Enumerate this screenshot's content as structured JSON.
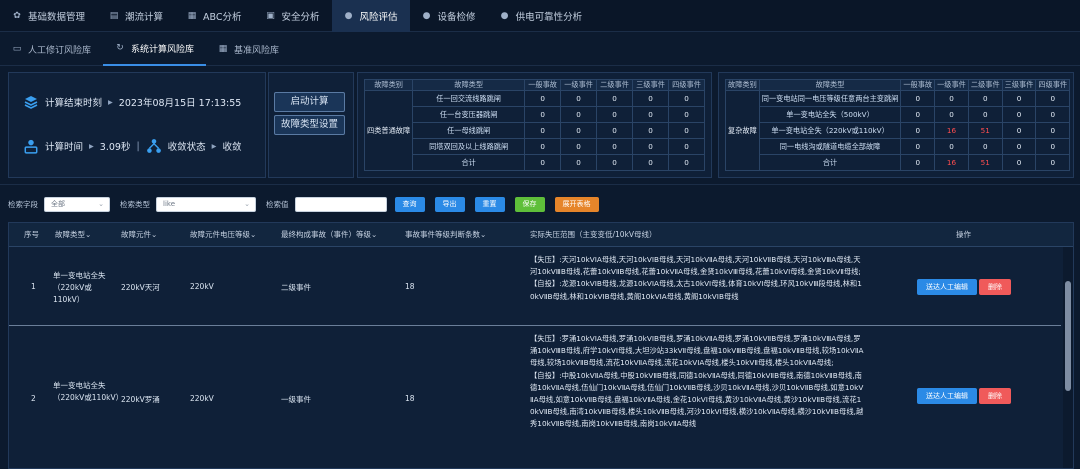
{
  "top_nav": [
    {
      "label": "基础数据管理",
      "icon": "gear-icon",
      "glyph": "✿"
    },
    {
      "label": "潮流计算",
      "icon": "document-icon",
      "glyph": "▤"
    },
    {
      "label": "ABC分析",
      "icon": "abc-icon",
      "glyph": "▦"
    },
    {
      "label": "安全分析",
      "icon": "monitor-icon",
      "glyph": "▣"
    },
    {
      "label": "风险评估",
      "icon": "user-icon",
      "glyph": "●",
      "active": true
    },
    {
      "label": "设备检修",
      "icon": "user-icon",
      "glyph": "●"
    },
    {
      "label": "供电可靠性分析",
      "icon": "user-icon",
      "glyph": "●"
    }
  ],
  "sub_nav": [
    {
      "label": "人工修订风险库",
      "icon": "monitor-icon",
      "glyph": "▭"
    },
    {
      "label": "系统计算风险库",
      "icon": "refresh-icon",
      "glyph": "↻",
      "active": true
    },
    {
      "label": "基准风险库",
      "icon": "grid-icon",
      "glyph": "▦"
    }
  ],
  "status": {
    "end_label": "计算结束时刻",
    "end_value": "2023年08月15日 17:13:55",
    "time_label": "计算时间",
    "time_value": "3.09秒",
    "sep": "|",
    "state_label": "收敛状态",
    "state_value": "收敛",
    "start_button": "启动计算",
    "fault_button": "故障类型设置"
  },
  "table_left": {
    "headers": [
      "故障类别",
      "故障类型",
      "一般事故",
      "一级事件",
      "二级事件",
      "三级事件",
      "四级事件"
    ],
    "category": "四类普通故障",
    "rows": [
      {
        "type": "任一回交流线路跳闸",
        "v": [
          "0",
          "0",
          "0",
          "0",
          "0"
        ]
      },
      {
        "type": "任一台变压器跳闸",
        "v": [
          "0",
          "0",
          "0",
          "0",
          "0"
        ]
      },
      {
        "type": "任一母线跳闸",
        "v": [
          "0",
          "0",
          "0",
          "0",
          "0"
        ]
      },
      {
        "type": "同塔双回及以上线路跳闸",
        "v": [
          "0",
          "0",
          "0",
          "0",
          "0"
        ]
      },
      {
        "type": "合计",
        "v": [
          "0",
          "0",
          "0",
          "0",
          "0"
        ]
      }
    ]
  },
  "table_right": {
    "headers": [
      "故障类别",
      "故障类型",
      "一般事故",
      "一级事件",
      "二级事件",
      "三级事件",
      "四级事件"
    ],
    "category": "复杂故障",
    "rows": [
      {
        "type": "同一变电站同一电压等级任意两台主变跳闸",
        "v": [
          "0",
          "0",
          "0",
          "0",
          "0"
        ]
      },
      {
        "type": "单一变电站全失（500kV）",
        "v": [
          "0",
          "0",
          "0",
          "0",
          "0"
        ]
      },
      {
        "type": "单一变电站全失（220kV或110kV）",
        "v": [
          "0",
          "16",
          "51",
          "0",
          "0"
        ]
      },
      {
        "type": "同一电线沟或隧道电缆全部故障",
        "v": [
          "0",
          "0",
          "0",
          "0",
          "0"
        ]
      },
      {
        "type": "合计",
        "v": [
          "0",
          "16",
          "51",
          "0",
          "0"
        ]
      }
    ]
  },
  "filter": {
    "field_label": "检索字段",
    "field_value": "全部",
    "kind_label": "检索类型",
    "kind_value": "like",
    "value_label": "检索值",
    "value_input": "",
    "buttons": [
      "查询",
      "导出",
      "重置",
      "保存",
      "展开表格"
    ]
  },
  "grid": {
    "headers": [
      "序号",
      "故障类型",
      "故障元件",
      "故障元件电压等级",
      "最终构成事故（事件）等级",
      "事故事件等级判断条数",
      "实际失压范围（主变变低/10kV母线）",
      "操作"
    ],
    "sort_mark": "⌄",
    "rows": [
      {
        "idx": "1",
        "fault_type": "单一变电站全失（220kV或110kV）",
        "element": "220kV天河",
        "voltage": "220kV",
        "level": "二级事件",
        "count": "18",
        "scope": "【失压】:天河10kVⅠA母线,天河10kVⅠB母线,天河10kVⅡA母线,天河10kVⅡB母线,天河10kVⅢA母线,天河10kVⅢB母线,花蕾10kVⅡB母线,花蕾10kVⅡA母线,金贤10kVⅢ母线,花蕾10kVⅠ母线,金贤10kVⅡ母线;\n【自投】:龙源10kVⅠB母线,龙源10kVⅠA母线,太古10kVⅠ母线,体育10kVⅠ母线,环风10kVⅢ段母线,林和10kVⅡB母线,林和10kVⅠB母线,黄阁10kVⅠA母线,黄阁10kVⅠB母线",
        "edit": "送达人工编辑",
        "delete": "删除"
      },
      {
        "idx": "2",
        "fault_type": "单一变电站全失（220kV或110kV）",
        "element": "220kV罗涌",
        "voltage": "220kV",
        "level": "一级事件",
        "count": "18",
        "scope": "【失压】:罗涌10kVⅠA母线,罗涌10kVⅠB母线,罗涌10kVⅡA母线,罗涌10kVⅡB母线,罗涌10kVⅢA母线,罗涌10kVⅢB母线,府学10kVⅠ母线,大坦沙站33kVⅡ母线,盘福10kVⅢB母线,盘福10kVⅡB母线,较场10kVⅡA母线,较场10kVⅡB母线,流花10kVⅡA母线,流花10kVⅠA母线,楼头10kVⅡ母线,楼头10kVⅡA母线;\n【自投】:中股10kVⅡA母线,中股10kVⅡB母线,同德10kVⅡA母线,同德10kVⅡB母线,南德10kVⅡB母线,南德10kVⅡA母线,伍仙门10kVⅡA母线,伍仙门10kVⅡB母线,沙贝10kVⅡA母线,沙贝10kVⅡB母线,如意10kVⅡA母线,如意10kVⅡB母线,盘福10kVⅡA母线,金花10kVⅠ母线,黄沙10kVⅡA母线,黄沙10kVⅡB母线,流花10kVⅡB母线,南湾10kVⅡB母线,楼头10kVⅡB母线,河沙10kVⅠ母线,横沙10kVⅡA母线,横沙10kVⅡB母线,越秀10kVⅡB母线,南岗10kVⅡB母线,南岗10kVⅡA母线",
        "edit": "送达人工编辑",
        "delete": "删除"
      }
    ]
  }
}
